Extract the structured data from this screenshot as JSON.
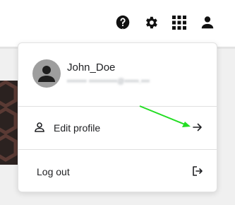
{
  "toolbar": {
    "icons": [
      "help-icon",
      "settings-icon",
      "apps-grid-icon",
      "account-icon"
    ]
  },
  "account_menu": {
    "user_name": "John_Doe",
    "user_email": "••••••• ••••••••••@•••••.•••",
    "edit_profile_label": "Edit profile",
    "logout_label": "Log out"
  },
  "annotation": {
    "arrow_color": "#22dd22"
  }
}
